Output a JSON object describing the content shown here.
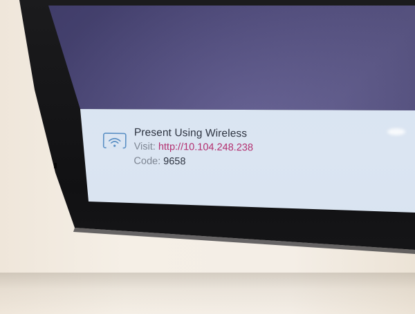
{
  "banner": {
    "icon": "wireless-screen-cast-icon",
    "title": "Present Using Wireless",
    "visit_label": "Visit:",
    "visit_url": "http://10.104.248.238",
    "code_label": "Code:",
    "code_value": "9658"
  },
  "colors": {
    "banner_bg": "#d9e4f1",
    "title_text": "#2d3340",
    "label_text": "#7d8592",
    "url_text": "#b32d6e",
    "screen_dark": "#4b4775",
    "bezel": "#111113"
  }
}
